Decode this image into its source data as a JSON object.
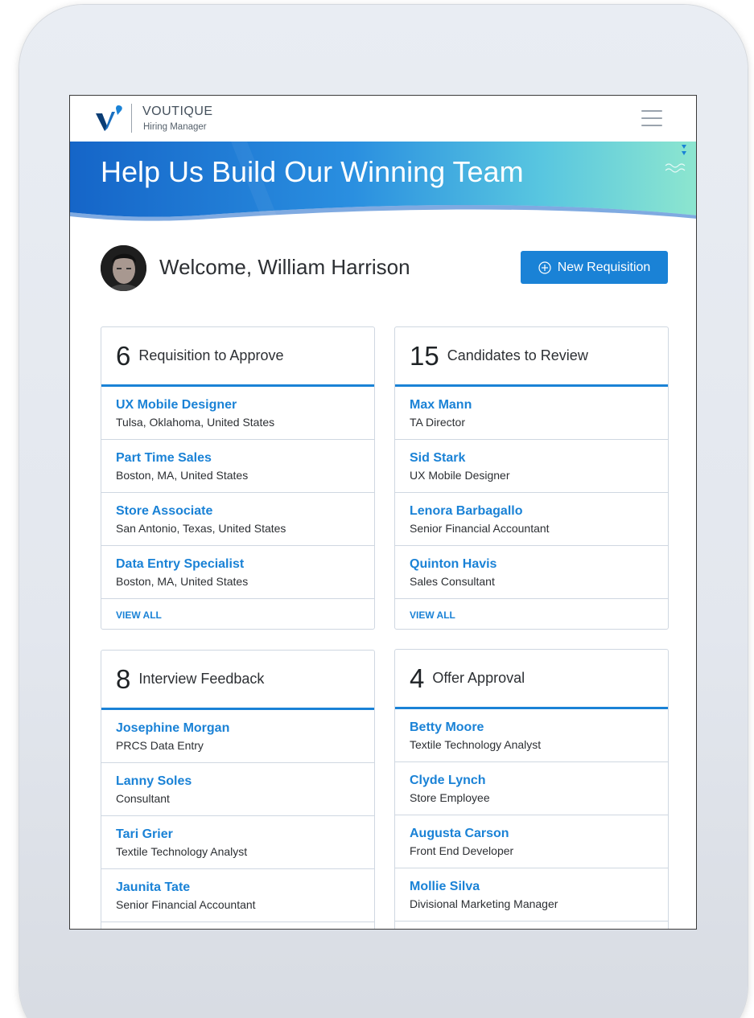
{
  "header": {
    "brand_name": "VOUTIQUE",
    "brand_role": "Hiring Manager"
  },
  "banner": {
    "title": "Help Us Build Our Winning Team"
  },
  "welcome": {
    "text": "Welcome, William Harrison"
  },
  "actions": {
    "new_requisition": "New Requisition"
  },
  "colors": {
    "accent": "#1a82d6",
    "banner_start": "#1565c0",
    "banner_end": "#7fe0d0"
  },
  "cards": [
    {
      "count": "6",
      "title": "Requisition to Approve",
      "items": [
        {
          "name": "UX Mobile Designer",
          "sub": "Tulsa, Oklahoma, United States"
        },
        {
          "name": "Part Time Sales",
          "sub": "Boston, MA, United States"
        },
        {
          "name": "Store Associate",
          "sub": "San Antonio, Texas, United States"
        },
        {
          "name": "Data Entry Specialist",
          "sub": "Boston, MA, United States"
        }
      ],
      "view_all": "VIEW ALL"
    },
    {
      "count": "15",
      "title": "Candidates to Review",
      "items": [
        {
          "name": "Max Mann",
          "sub": "TA Director"
        },
        {
          "name": "Sid Stark",
          "sub": "UX Mobile Designer"
        },
        {
          "name": "Lenora Barbagallo",
          "sub": "Senior Financial Accountant"
        },
        {
          "name": "Quinton Havis",
          "sub": "Sales Consultant"
        }
      ],
      "view_all": "VIEW ALL"
    },
    {
      "count": "8",
      "title": "Interview Feedback",
      "items": [
        {
          "name": "Josephine Morgan",
          "sub": "PRCS Data Entry"
        },
        {
          "name": "Lanny Soles",
          "sub": "Consultant"
        },
        {
          "name": "Tari Grier",
          "sub": "Textile Technology Analyst"
        },
        {
          "name": "Jaunita Tate",
          "sub": "Senior Financial Accountant"
        }
      ]
    },
    {
      "count": "4",
      "title": "Offer Approval",
      "items": [
        {
          "name": "Betty Moore",
          "sub": "Textile Technology Analyst"
        },
        {
          "name": "Clyde Lynch",
          "sub": "Store Employee"
        },
        {
          "name": "Augusta Carson",
          "sub": "Front End Developer"
        },
        {
          "name": "Mollie Silva",
          "sub": "Divisional Marketing Manager"
        }
      ]
    }
  ]
}
